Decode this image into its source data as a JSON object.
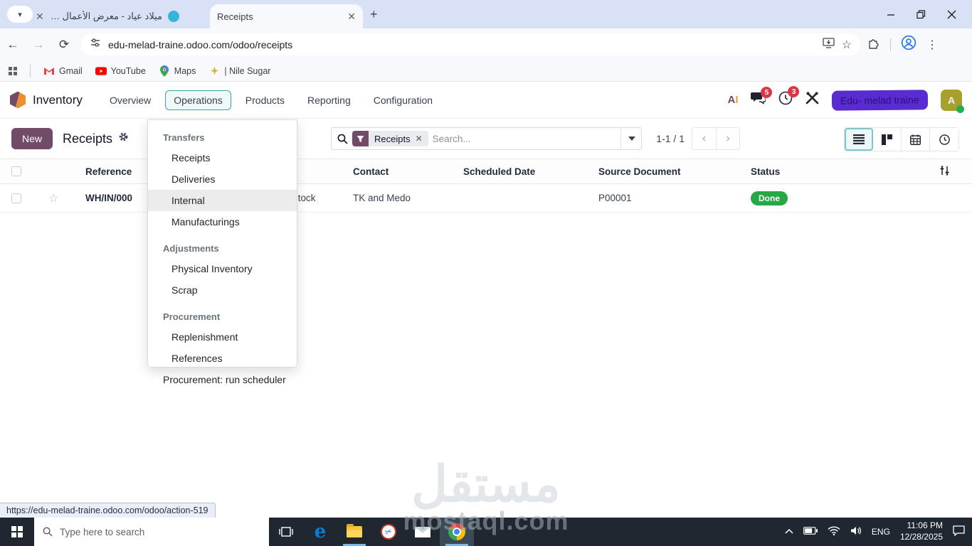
{
  "browser": {
    "tab_search_icon": "chevron-down",
    "tabs": [
      {
        "title": "ميلاد عياد - معرض الأعمال | مستة",
        "close": "✕"
      },
      {
        "title": "Receipts",
        "close": "✕"
      }
    ],
    "new_tab": "+",
    "url": "edu-melad-traine.odoo.com/odoo/receipts",
    "bookmarks": {
      "gmail": "Gmail",
      "youtube": "YouTube",
      "maps": "Maps",
      "nile": "| Nile Sugar"
    }
  },
  "navbar": {
    "app_name": "Inventory",
    "menus": {
      "overview": "Overview",
      "operations": "Operations",
      "products": "Products",
      "reporting": "Reporting",
      "configuration": "Configuration"
    },
    "message_badge": "5",
    "activity_badge": "3",
    "ai_a": "A",
    "ai_i": "I",
    "user_name": "Edu- melad traine",
    "avatar_letter": "A"
  },
  "control_panel": {
    "new_label": "New",
    "title": "Receipts",
    "filter_chip": "Receipts",
    "chip_close": "✕",
    "search_placeholder": "Search...",
    "pager": "1-1 / 1",
    "prev": "‹",
    "next": "›"
  },
  "operations_menu": {
    "sections": [
      {
        "header": "Transfers",
        "items": [
          "Receipts",
          "Deliveries",
          "Internal",
          "Manufacturings"
        ]
      },
      {
        "header": "Adjustments",
        "items": [
          "Physical Inventory",
          "Scrap"
        ]
      },
      {
        "header": "Procurement",
        "items": [
          "Replenishment",
          "References"
        ]
      }
    ],
    "footer_item": "Procurement: run scheduler",
    "hovered_item": "Internal"
  },
  "table": {
    "columns": {
      "reference": "Reference",
      "contact": "Contact",
      "scheduled_date": "Scheduled Date",
      "source_document": "Source Document",
      "status": "Status"
    },
    "rows": [
      {
        "star": "☆",
        "reference": "WH/IN/000",
        "from": "/Stock",
        "contact": "TK and Medo",
        "scheduled_date": "",
        "source_document": "P00001",
        "status": "Done"
      }
    ]
  },
  "status_bar": {
    "link_preview": "https://edu-melad-traine.odoo.com/odoo/action-519"
  },
  "taskbar": {
    "search_placeholder": "Type here to search",
    "language": "ENG",
    "time": "11:06 PM",
    "date": "12/28/2025"
  },
  "watermark": {
    "arabic": "مستقل",
    "latin": "mostaql.com"
  },
  "colors": {
    "odoo_primary": "#714B67",
    "accent_teal": "#39a5aa",
    "done_green": "#28a745",
    "highlight_purple": "#5a2bd0"
  }
}
